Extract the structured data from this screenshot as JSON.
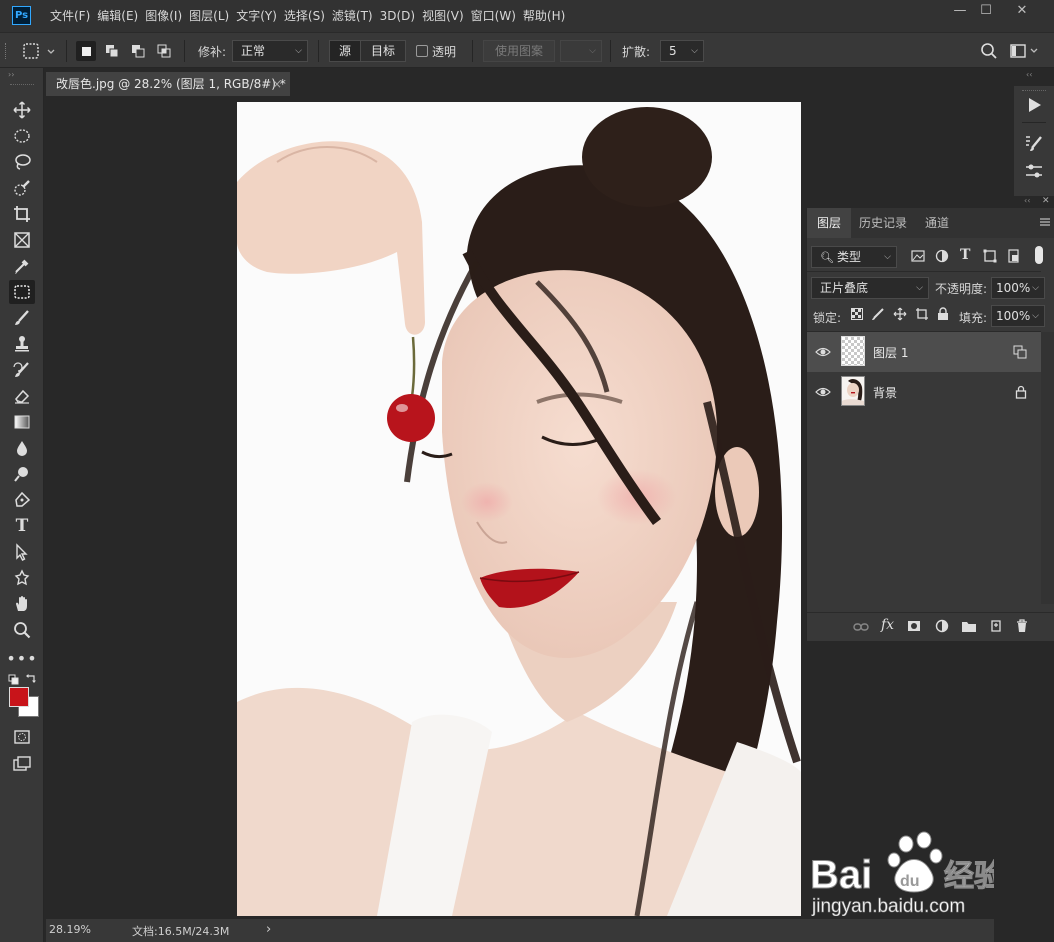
{
  "app": {
    "logo": "Ps"
  },
  "menu": [
    "文件(F)",
    "编辑(E)",
    "图像(I)",
    "图层(L)",
    "文字(Y)",
    "选择(S)",
    "滤镜(T)",
    "3D(D)",
    "视图(V)",
    "窗口(W)",
    "帮助(H)"
  ],
  "window_controls": {
    "minimize": "—",
    "maximize": "☐",
    "close": "✕"
  },
  "options": {
    "patch_label": "修补:",
    "patch_value": "正常",
    "source_label": "源",
    "target_label": "目标",
    "transparent_label": "透明",
    "use_pattern_label": "使用图案",
    "expand_label": "扩散:",
    "expand_value": "5"
  },
  "document": {
    "tab_title": "改唇色.jpg @ 28.2% (图层 1, RGB/8#) *",
    "close": "×"
  },
  "status": {
    "zoom": "28.19%",
    "doc_info": "文档:16.5M/24.3M",
    "arrow": "›"
  },
  "panels": {
    "tabs": [
      "图层",
      "历史记录",
      "通道"
    ],
    "filter_label": "类型",
    "blend_mode": "正片叠底",
    "opacity_label": "不透明度:",
    "opacity_value": "100%",
    "lock_label": "锁定:",
    "fill_label": "填充:",
    "fill_value": "100%",
    "layers": [
      {
        "name": "图层 1",
        "selected": true
      },
      {
        "name": "背景",
        "selected": false,
        "locked": true
      }
    ]
  },
  "watermark": {
    "brand": "Bai",
    "brand2": "du",
    "cn": "经验",
    "url": "jingyan.baidu.com"
  },
  "colors": {
    "foreground": "#c8141a",
    "background": "#ffffff",
    "accent": "#31a8ff"
  },
  "icons": {
    "toolbar": [
      "move-icon",
      "marquee-icon",
      "lasso-icon",
      "quick-select-icon",
      "crop-icon",
      "frame-icon",
      "eyedropper-icon",
      "patch-icon",
      "brush-icon",
      "stamp-icon",
      "history-brush-icon",
      "eraser-icon",
      "gradient-icon",
      "blur-icon",
      "dodge-icon",
      "pen-icon",
      "type-icon",
      "path-select-icon",
      "shape-icon",
      "hand-icon",
      "zoom-icon",
      "more-icon"
    ]
  }
}
